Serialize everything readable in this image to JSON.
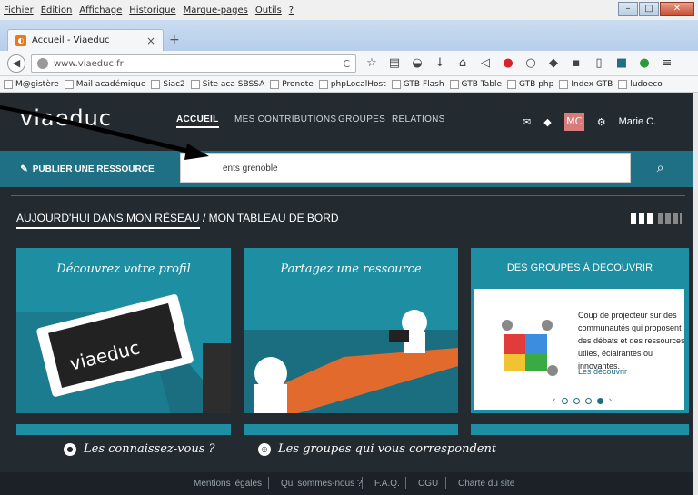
{
  "menubar": {
    "items": [
      "Fichier",
      "Édition",
      "Affichage",
      "Historique",
      "Marque-pages",
      "Outils",
      "?"
    ]
  },
  "tab": {
    "title": "Accueil - Viaeduc",
    "close": "×",
    "new": "+"
  },
  "nav": {
    "url": "www.viaeduc.fr",
    "reload": "C"
  },
  "bookmarks": [
    "M@gistère",
    "Mail académique",
    "Siac2",
    "Site aca SBSSA",
    "Pronote",
    "phpLocalHost",
    "GTB Flash",
    "GTB Table",
    "GTB php",
    "Index GTB",
    "ludoeco"
  ],
  "site": {
    "logo": "viaeduc",
    "nav": {
      "accueil": "ACCUEIL",
      "contributions": "MES CONTRIBUTIONS",
      "groupes": "GROUPES",
      "relations": "RELATIONS"
    },
    "avatar": "MC",
    "user": "Marie C."
  },
  "search": {
    "publish_label": "PUBLIER UNE RESSOURCE",
    "value": "ents grenoble"
  },
  "dash": {
    "active": "AUJOURD'HUI DANS MON RÉSEAU",
    "sep": " / ",
    "other": "MON TABLEAU DE BORD"
  },
  "cards": {
    "c1": {
      "title": "Découvrez votre profil",
      "logo": "viaeduc"
    },
    "c2": {
      "title": "Partagez une ressource"
    },
    "c3": {
      "title": "DES GROUPES À DÉCOUVRIR",
      "text": "Coup de projecteur sur des communautés qui proposent des débats et des ressources utiles, éclairantes ou innovantes.",
      "link": "Les découvrir",
      "prev": "‹",
      "next": "›"
    }
  },
  "subs": {
    "s1": "Les connaissez-vous ?",
    "s2": "Les groupes qui vous correspondent"
  },
  "footer": [
    "Mentions légales",
    "Qui sommes-nous ?",
    "F.A.Q.",
    "CGU",
    "Charte du site"
  ],
  "colors": {
    "teal": "#1e8fa3",
    "dark": "#232a30",
    "accent": "#1f6f85"
  }
}
